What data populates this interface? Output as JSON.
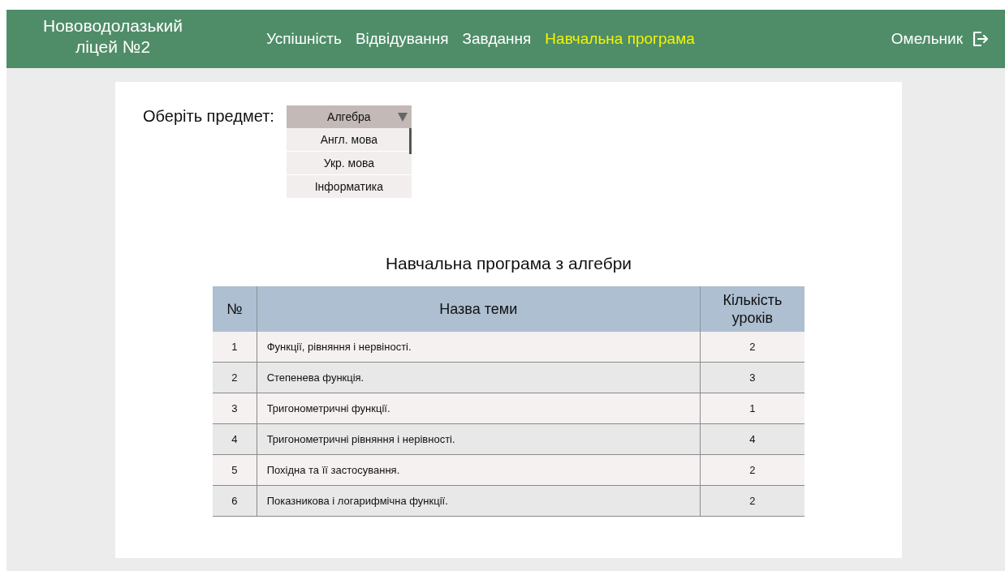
{
  "header": {
    "school": "Нововодолазький ліцей №2",
    "nav": [
      {
        "label": "Успішність",
        "selected": false
      },
      {
        "label": "Відвідування",
        "selected": false
      },
      {
        "label": "Завдання",
        "selected": false
      },
      {
        "label": "Навчальна програма",
        "selected": true
      }
    ],
    "user": "Омельник"
  },
  "subject_picker": {
    "label": "Оберіть предмет:",
    "value": "Алгебра",
    "expanded": true,
    "options": [
      "Англ. мова",
      "Укр. мова",
      "Інформатика"
    ]
  },
  "table": {
    "title": "Навчальна програма з алгебри",
    "columns": [
      "№",
      "Назва теми",
      "Кількість уроків"
    ],
    "rows": [
      [
        "1",
        "Функції, рівняння і нервіності.",
        "2"
      ],
      [
        "2",
        "Степенева функція.",
        "3"
      ],
      [
        "3",
        "Тригонометричні функції.",
        "1"
      ],
      [
        "4",
        "Тригонометричні рівняння і нерівності.",
        "4"
      ],
      [
        "5",
        "Похідна та її застосування.",
        "2"
      ],
      [
        "6",
        "Показникова і логарифмічна функції.",
        "2"
      ]
    ]
  }
}
